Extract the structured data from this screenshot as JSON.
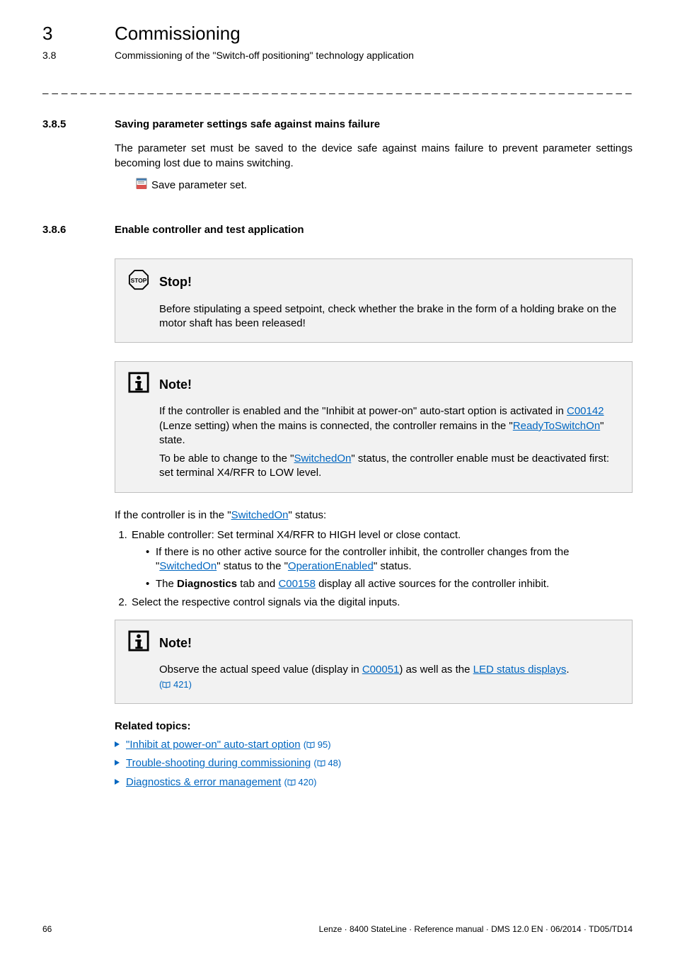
{
  "header": {
    "chapter_number": "3",
    "chapter_title": "Commissioning",
    "section_number": "3.8",
    "section_title": "Commissioning of the \"Switch-off positioning\" technology application"
  },
  "dash_line": "_ _ _ _ _ _ _ _ _ _ _ _ _ _ _ _ _ _ _ _ _ _ _ _ _ _ _ _ _ _ _ _ _ _ _ _ _ _ _ _ _ _ _ _ _ _ _ _ _ _ _ _ _ _ _ _ _ _ _ _ _ _ _ _",
  "sec385": {
    "num": "3.8.5",
    "title": "Saving parameter settings safe against mains failure",
    "body": "The parameter set must be saved to the device safe against mains failure to prevent parameter settings becoming lost due to mains switching.",
    "save_label": "Save parameter set."
  },
  "sec386": {
    "num": "3.8.6",
    "title": "Enable controller and test application"
  },
  "stop_box": {
    "title": "Stop!",
    "body": "Before stipulating a speed setpoint, check whether the brake in the form of a holding brake on the motor shaft has been released!"
  },
  "note_box1": {
    "title": "Note!",
    "p1_pre": "If the controller is enabled and the \"Inhibit at power-on\" auto-start option is activated in ",
    "p1_link1": "C00142",
    "p1_mid": " (Lenze setting) when the mains is connected, the controller remains in the \"",
    "p1_link2": "ReadyToSwitchOn",
    "p1_post": "\" state.",
    "p2_pre": "To be able to change to the \"",
    "p2_link": "SwitchedOn",
    "p2_post": "\" status, the controller enable must be deactivated first: set terminal X4/RFR to LOW level."
  },
  "status_sentence": {
    "pre": "If the controller is in the \"",
    "link": "SwitchedOn",
    "post": "\" status:"
  },
  "steps": {
    "s1": "Enable controller: Set terminal X4/RFR to HIGH level or close contact.",
    "s1b1_pre": "If there is no other active source for the controller inhibit, the controller changes from the \"",
    "s1b1_link1": "SwitchedOn",
    "s1b1_mid": "\" status to the \"",
    "s1b1_link2": "OperationEnabled",
    "s1b1_post": "\" status.",
    "s1b2_pre": "The ",
    "s1b2_bold": "Diagnostics",
    "s1b2_mid": " tab and ",
    "s1b2_link": "C00158",
    "s1b2_post": " display all active sources for the controller inhibit.",
    "s2": "Select the respective control signals via the digital inputs."
  },
  "note_box2": {
    "title": "Note!",
    "pre": "Observe the actual speed value (display in ",
    "link1": "C00051",
    "mid": ") as well as the ",
    "link2": "LED status displays",
    "post": ".",
    "ref": "421"
  },
  "related": {
    "title": "Related topics:",
    "items": [
      {
        "text": "\"Inhibit at power-on\" auto-start option",
        "ref": "95"
      },
      {
        "text": "Trouble-shooting during commissioning",
        "ref": "48"
      },
      {
        "text": "Diagnostics & error management",
        "ref": "420"
      }
    ]
  },
  "footer": {
    "page": "66",
    "info": "Lenze · 8400 StateLine · Reference manual · DMS 12.0 EN · 06/2014 · TD05/TD14"
  }
}
